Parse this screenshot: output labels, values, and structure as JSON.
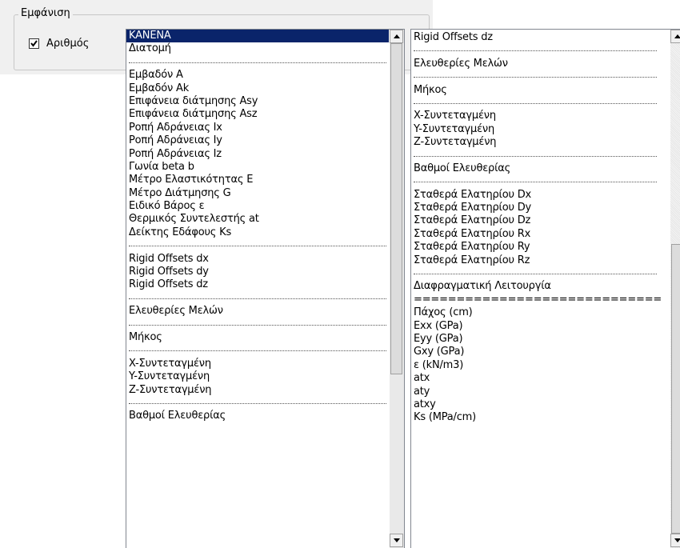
{
  "group": {
    "title": "Εμφάνιση",
    "checkbox_label": "Αριθμός",
    "checkbox_checked": true
  },
  "list1": {
    "items": [
      "KANENA",
      "Διατομή",
      "---",
      "Εμβαδόν A",
      "Εμβαδόν Ak",
      "Επιφάνεια διάτμησης Asy",
      "Επιφάνεια διάτμησης Asz",
      "Ροπή Αδράνειας Ix",
      "Ροπή Αδράνειας Iy",
      "Ροπή Αδράνειας Iz",
      "Γωνία beta b",
      "Μέτρο Ελαστικότητας E",
      "Μέτρο Διάτμησης G",
      "Ειδικό Βάρος ε",
      "Θερμικός Συντελεστής at",
      "Δείκτης Εδάφους Ks",
      "---",
      "Rigid Offsets dx",
      "Rigid Offsets dy",
      "Rigid Offsets dz",
      "---",
      "Ελευθερίες Μελών",
      "---",
      "Μήκος",
      "---",
      "X-Συντεταγμένη",
      "Y-Συντεταγμένη",
      "Z-Συντεταγμένη",
      "---",
      "Βαθμοί Ελευθερίας"
    ],
    "selected_index": 0
  },
  "list2": {
    "items": [
      "Rigid Offsets dz",
      "---",
      "Ελευθερίες Μελών",
      "---",
      "Μήκος",
      "---",
      "X-Συντεταγμένη",
      "Y-Συντεταγμένη",
      "Z-Συντεταγμένη",
      "---",
      "Βαθμοί Ελευθερίας",
      "---",
      "Σταθερά Ελατηρίου Dx",
      "Σταθερά Ελατηρίου Dy",
      "Σταθερά Ελατηρίου Dz",
      "Σταθερά Ελατηρίου Rx",
      "Σταθερά Ελατηρίου Ry",
      "Σταθερά Ελατηρίου Rz",
      "---",
      "Διαφραγματική Λειτουργία",
      "=============================",
      "Πάχος (cm)",
      "Exx (GPa)",
      "Eyy (GPa)",
      "Gxy (GPa)",
      "ε (kN/m3)",
      "atx",
      "aty",
      "atxy",
      "Ks (MPa/cm)"
    ]
  },
  "colors": {
    "selection": "#0a246a",
    "panel": "#f0f0f0"
  }
}
